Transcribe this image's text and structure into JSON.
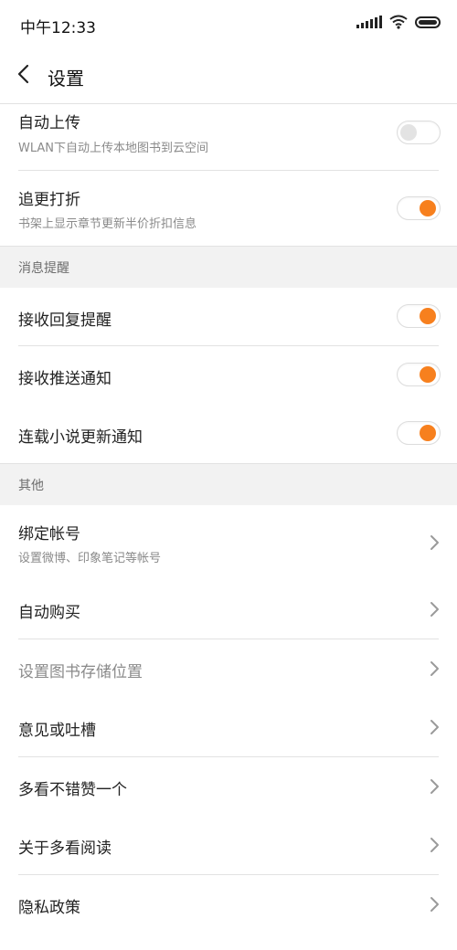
{
  "status_bar": {
    "time": "中午12:33"
  },
  "header": {
    "title": "设置"
  },
  "items": {
    "auto_upload": {
      "title": "自动上传",
      "subtitle": "WLAN下自动上传本地图书到云空间",
      "enabled": false
    },
    "follow_discount": {
      "title": "追更打折",
      "subtitle": "书架上显示章节更新半价折扣信息",
      "enabled": true
    }
  },
  "sections": {
    "notifications": {
      "label": "消息提醒"
    },
    "other": {
      "label": "其他"
    }
  },
  "notifications": {
    "reply": {
      "title": "接收回复提醒",
      "enabled": true
    },
    "push": {
      "title": "接收推送通知",
      "enabled": true
    },
    "serial": {
      "title": "连载小说更新通知",
      "enabled": true
    }
  },
  "other": {
    "bind_account": {
      "title": "绑定帐号",
      "subtitle": "设置微博、印象笔记等帐号"
    },
    "auto_buy": {
      "title": "自动购买"
    },
    "storage": {
      "title": "设置图书存储位置"
    },
    "feedback": {
      "title": "意见或吐槽"
    },
    "praise": {
      "title": "多看不错赞一个"
    },
    "about": {
      "title": "关于多看阅读"
    },
    "privacy": {
      "title": "隐私政策"
    }
  },
  "colors": {
    "accent": "#f7801e",
    "section_bg": "#f2f2f2",
    "toggle_off_knob": "#e3e3e3"
  }
}
